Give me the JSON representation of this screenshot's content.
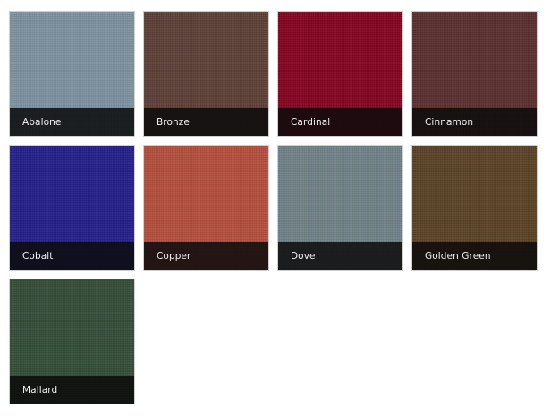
{
  "swatches": [
    {
      "name": "Abalone",
      "color": "#7b929e"
    },
    {
      "name": "Bronze",
      "color": "#5b3f36"
    },
    {
      "name": "Cardinal",
      "color": "#85031f"
    },
    {
      "name": "Cinnamon",
      "color": "#592f2e"
    },
    {
      "name": "Cobalt",
      "color": "#231e88"
    },
    {
      "name": "Copper",
      "color": "#b34e3c"
    },
    {
      "name": "Dove",
      "color": "#6f8187"
    },
    {
      "name": "Golden Green",
      "color": "#5a4225"
    },
    {
      "name": "Mallard",
      "color": "#334d38"
    }
  ]
}
